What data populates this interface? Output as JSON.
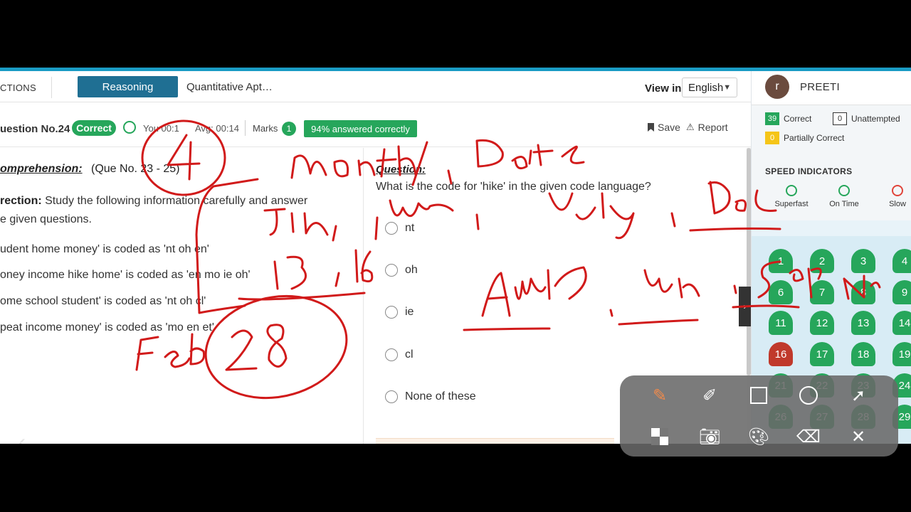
{
  "header": {
    "sections_label": "CTIONS",
    "tabs": [
      {
        "label": "Reasoning",
        "active": true
      },
      {
        "label": "Quantitative Apt…",
        "active": false
      }
    ],
    "view_in_label": "View in",
    "language": "English"
  },
  "question_info": {
    "number_label": "uestion No.24",
    "status": "Correct",
    "you_time": "You 00:1",
    "avg_time": "Avg: 00:14",
    "marks_label": "Marks",
    "marks_value": "1",
    "answered_pct": "94% answered correctly",
    "save_label": "Save",
    "report_label": "Report"
  },
  "passage": {
    "comp_label": "omprehension:",
    "que_range": "(Que No. 23 - 25)",
    "direction_label": "rection:",
    "direction_text": "Study the following information carefully and answer",
    "direction_text2": "e given questions.",
    "code_lines": [
      "udent home money' is coded as 'nt oh en'",
      "oney income hike home' is coded as 'en mo ie oh'",
      "ome school student' is coded as 'nt oh cl'",
      "peat income money' is coded as 'mo en et'"
    ]
  },
  "question": {
    "label": "Question:",
    "text": "What is the code for 'hike' in the given code language?",
    "options": [
      "nt",
      "oh",
      "ie",
      "cl",
      "None of these"
    ]
  },
  "sidebar": {
    "avatar_letter": "r",
    "username": "PREETI",
    "stats": {
      "correct_count": "39",
      "correct_label": "Correct",
      "unattempted_count": "0",
      "unattempted_label": "Unattempted",
      "partial_count": "0",
      "partial_label": "Partially Correct"
    },
    "speed_title": "SPEED INDICATORS",
    "speed_indicators": [
      "Superfast",
      "On Time",
      "Slow"
    ],
    "question_numbers": [
      "1",
      "2",
      "3",
      "4",
      "6",
      "7",
      "8",
      "9",
      "11",
      "12",
      "13",
      "14",
      "16",
      "17",
      "18",
      "19",
      "21",
      "22",
      "23",
      "24",
      "26",
      "27",
      "28",
      "29"
    ],
    "wrong_question": "16"
  },
  "annotation": {
    "handwriting": [
      "4",
      "month / Date",
      "Jan, Mar, July, Dec",
      "13, 16",
      "Feb 28",
      "April, June, Sep, Nov"
    ]
  },
  "colors": {
    "accent": "#1a9bc4",
    "tab_active": "#1f6f93",
    "correct_green": "#26a65b",
    "wrong_red": "#c0392b",
    "ink_red": "#d11a1a"
  },
  "icons": [
    "timer-icon",
    "bookmark-icon",
    "warning-icon",
    "chevron-down-icon",
    "superfast-icon",
    "on-time-icon",
    "slow-icon",
    "pen-icon",
    "highlighter-icon",
    "square-icon",
    "circle-icon",
    "arrow-icon",
    "mosaic-icon",
    "camera-icon",
    "palette-icon",
    "eraser-icon",
    "close-icon"
  ]
}
